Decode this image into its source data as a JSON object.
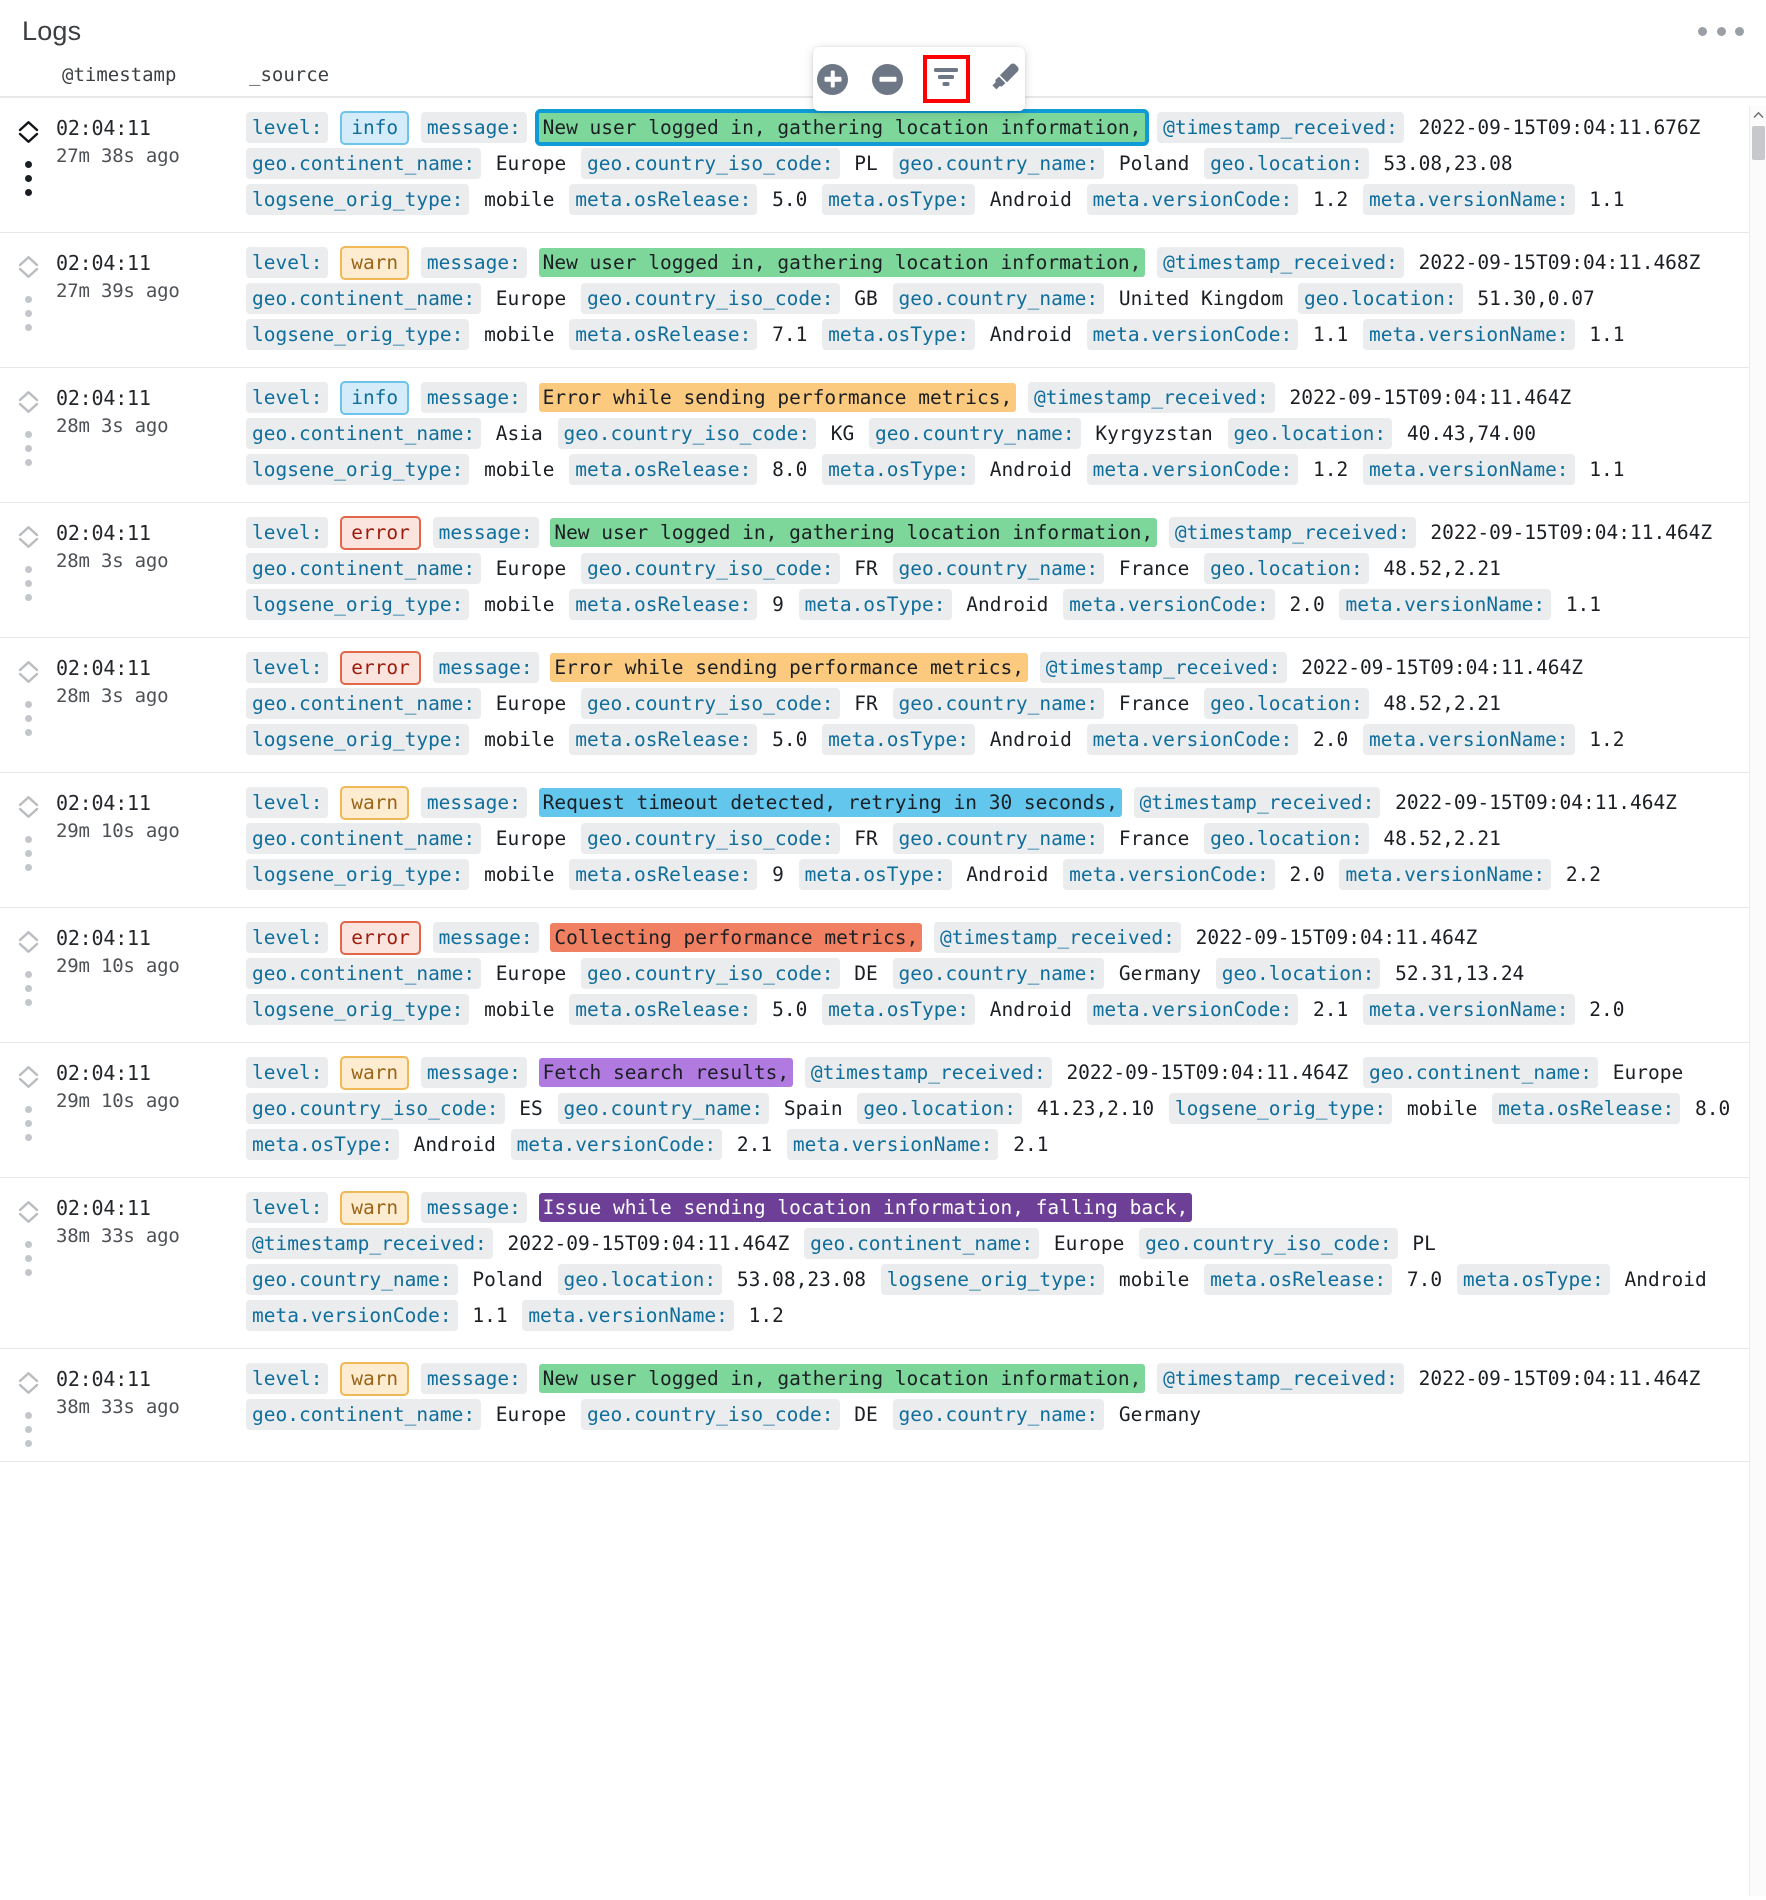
{
  "panel": {
    "title": "Logs",
    "menu_icon": "kebab-menu-icon"
  },
  "toolbar": {
    "buttons": [
      {
        "name": "zoom-in-button",
        "icon": "plus-circle-icon",
        "selected": false
      },
      {
        "name": "zoom-out-button",
        "icon": "minus-circle-icon",
        "selected": false
      },
      {
        "name": "filter-button",
        "icon": "funnel-icon",
        "selected": true
      },
      {
        "name": "highlight-button",
        "icon": "marker-pen-icon",
        "selected": false
      }
    ],
    "selection_color": "#ff0000"
  },
  "columns": {
    "timestamp": "@timestamp",
    "source": "_source"
  },
  "colors": {
    "field_label_text": "#0f6e9b",
    "field_label_bg": "#ebecee",
    "info_bg": "#d4ecf9",
    "warn_bg": "#fdecd0",
    "error_bg": "#fbe3de",
    "hl_green": "#7ed79a",
    "hl_orange": "#fcca7f",
    "hl_cyan": "#62c6ed",
    "hl_salmon": "#f08061",
    "hl_purple": "#b07ae0",
    "hl_darkpurple": "#6d3f96",
    "outline_blue": "#109ad6"
  },
  "rows": [
    {
      "time": "02:04:11",
      "ago": "27m 38s ago",
      "active": true,
      "level": "info",
      "message": "New user logged in, gathering location information,",
      "hl_bg": "#7ed79a",
      "hl_fg": "#1b1f24",
      "outlined": true,
      "fields": [
        {
          "label": "@timestamp_received:",
          "value": "2022-09-15T09:04:11.676Z"
        },
        {
          "label": "geo.continent_name:",
          "value": "Europe"
        },
        {
          "label": "geo.country_iso_code:",
          "value": "PL"
        },
        {
          "label": "geo.country_name:",
          "value": "Poland"
        },
        {
          "label": "geo.location:",
          "value": "53.08,23.08"
        },
        {
          "label": "logsene_orig_type:",
          "value": "mobile"
        },
        {
          "label": "meta.osRelease:",
          "value": "5.0"
        },
        {
          "label": "meta.osType:",
          "value": "Android"
        },
        {
          "label": "meta.versionCode:",
          "value": "1.2"
        },
        {
          "label": "meta.versionName:",
          "value": "1.1"
        }
      ]
    },
    {
      "time": "02:04:11",
      "ago": "27m 39s ago",
      "active": false,
      "level": "warn",
      "message": "New user logged in, gathering location information,",
      "hl_bg": "#7ed79a",
      "hl_fg": "#1b1f24",
      "outlined": false,
      "fields": [
        {
          "label": "@timestamp_received:",
          "value": "2022-09-15T09:04:11.468Z"
        },
        {
          "label": "geo.continent_name:",
          "value": "Europe"
        },
        {
          "label": "geo.country_iso_code:",
          "value": "GB"
        },
        {
          "label": "geo.country_name:",
          "value": "United Kingdom"
        },
        {
          "label": "geo.location:",
          "value": "51.30,0.07"
        },
        {
          "label": "logsene_orig_type:",
          "value": "mobile"
        },
        {
          "label": "meta.osRelease:",
          "value": "7.1"
        },
        {
          "label": "meta.osType:",
          "value": "Android"
        },
        {
          "label": "meta.versionCode:",
          "value": "1.1"
        },
        {
          "label": "meta.versionName:",
          "value": "1.1"
        }
      ]
    },
    {
      "time": "02:04:11",
      "ago": "28m 3s ago",
      "active": false,
      "level": "info",
      "message": "Error while sending performance metrics,",
      "hl_bg": "#fcca7f",
      "hl_fg": "#1b1f24",
      "outlined": false,
      "fields": [
        {
          "label": "@timestamp_received:",
          "value": "2022-09-15T09:04:11.464Z"
        },
        {
          "label": "geo.continent_name:",
          "value": "Asia"
        },
        {
          "label": "geo.country_iso_code:",
          "value": "KG"
        },
        {
          "label": "geo.country_name:",
          "value": "Kyrgyzstan"
        },
        {
          "label": "geo.location:",
          "value": "40.43,74.00"
        },
        {
          "label": "logsene_orig_type:",
          "value": "mobile"
        },
        {
          "label": "meta.osRelease:",
          "value": "8.0"
        },
        {
          "label": "meta.osType:",
          "value": "Android"
        },
        {
          "label": "meta.versionCode:",
          "value": "1.2"
        },
        {
          "label": "meta.versionName:",
          "value": "1.1"
        }
      ]
    },
    {
      "time": "02:04:11",
      "ago": "28m 3s ago",
      "active": false,
      "level": "error",
      "message": "New user logged in, gathering location information,",
      "hl_bg": "#7ed79a",
      "hl_fg": "#1b1f24",
      "outlined": false,
      "fields": [
        {
          "label": "@timestamp_received:",
          "value": "2022-09-15T09:04:11.464Z"
        },
        {
          "label": "geo.continent_name:",
          "value": "Europe"
        },
        {
          "label": "geo.country_iso_code:",
          "value": "FR"
        },
        {
          "label": "geo.country_name:",
          "value": "France"
        },
        {
          "label": "geo.location:",
          "value": "48.52,2.21"
        },
        {
          "label": "logsene_orig_type:",
          "value": "mobile"
        },
        {
          "label": "meta.osRelease:",
          "value": "9"
        },
        {
          "label": "meta.osType:",
          "value": "Android"
        },
        {
          "label": "meta.versionCode:",
          "value": "2.0"
        },
        {
          "label": "meta.versionName:",
          "value": "1.1"
        }
      ]
    },
    {
      "time": "02:04:11",
      "ago": "28m 3s ago",
      "active": false,
      "level": "error",
      "message": "Error while sending performance metrics,",
      "hl_bg": "#fcca7f",
      "hl_fg": "#1b1f24",
      "outlined": false,
      "fields": [
        {
          "label": "@timestamp_received:",
          "value": "2022-09-15T09:04:11.464Z"
        },
        {
          "label": "geo.continent_name:",
          "value": "Europe"
        },
        {
          "label": "geo.country_iso_code:",
          "value": "FR"
        },
        {
          "label": "geo.country_name:",
          "value": "France"
        },
        {
          "label": "geo.location:",
          "value": "48.52,2.21"
        },
        {
          "label": "logsene_orig_type:",
          "value": "mobile"
        },
        {
          "label": "meta.osRelease:",
          "value": "5.0"
        },
        {
          "label": "meta.osType:",
          "value": "Android"
        },
        {
          "label": "meta.versionCode:",
          "value": "2.0"
        },
        {
          "label": "meta.versionName:",
          "value": "1.2"
        }
      ]
    },
    {
      "time": "02:04:11",
      "ago": "29m 10s ago",
      "active": false,
      "level": "warn",
      "message": "Request timeout detected, retrying in 30 seconds,",
      "hl_bg": "#62c6ed",
      "hl_fg": "#1b1f24",
      "outlined": false,
      "fields": [
        {
          "label": "@timestamp_received:",
          "value": "2022-09-15T09:04:11.464Z"
        },
        {
          "label": "geo.continent_name:",
          "value": "Europe"
        },
        {
          "label": "geo.country_iso_code:",
          "value": "FR"
        },
        {
          "label": "geo.country_name:",
          "value": "France"
        },
        {
          "label": "geo.location:",
          "value": "48.52,2.21"
        },
        {
          "label": "logsene_orig_type:",
          "value": "mobile"
        },
        {
          "label": "meta.osRelease:",
          "value": "9"
        },
        {
          "label": "meta.osType:",
          "value": "Android"
        },
        {
          "label": "meta.versionCode:",
          "value": "2.0"
        },
        {
          "label": "meta.versionName:",
          "value": "2.2"
        }
      ]
    },
    {
      "time": "02:04:11",
      "ago": "29m 10s ago",
      "active": false,
      "level": "error",
      "message": "Collecting performance metrics,",
      "hl_bg": "#f08061",
      "hl_fg": "#1b1f24",
      "outlined": false,
      "fields": [
        {
          "label": "@timestamp_received:",
          "value": "2022-09-15T09:04:11.464Z"
        },
        {
          "label": "geo.continent_name:",
          "value": "Europe"
        },
        {
          "label": "geo.country_iso_code:",
          "value": "DE"
        },
        {
          "label": "geo.country_name:",
          "value": "Germany"
        },
        {
          "label": "geo.location:",
          "value": "52.31,13.24"
        },
        {
          "label": "logsene_orig_type:",
          "value": "mobile"
        },
        {
          "label": "meta.osRelease:",
          "value": "5.0"
        },
        {
          "label": "meta.osType:",
          "value": "Android"
        },
        {
          "label": "meta.versionCode:",
          "value": "2.1"
        },
        {
          "label": "meta.versionName:",
          "value": "2.0"
        }
      ]
    },
    {
      "time": "02:04:11",
      "ago": "29m 10s ago",
      "active": false,
      "level": "warn",
      "message": "Fetch search results,",
      "hl_bg": "#b07ae0",
      "hl_fg": "#1b1f24",
      "outlined": false,
      "fields": [
        {
          "label": "@timestamp_received:",
          "value": "2022-09-15T09:04:11.464Z"
        },
        {
          "label": "geo.continent_name:",
          "value": "Europe"
        },
        {
          "label": "geo.country_iso_code:",
          "value": "ES"
        },
        {
          "label": "geo.country_name:",
          "value": "Spain"
        },
        {
          "label": "geo.location:",
          "value": "41.23,2.10"
        },
        {
          "label": "logsene_orig_type:",
          "value": "mobile"
        },
        {
          "label": "meta.osRelease:",
          "value": "8.0"
        },
        {
          "label": "meta.osType:",
          "value": "Android"
        },
        {
          "label": "meta.versionCode:",
          "value": "2.1"
        },
        {
          "label": "meta.versionName:",
          "value": "2.1"
        }
      ]
    },
    {
      "time": "02:04:11",
      "ago": "38m 33s ago",
      "active": false,
      "level": "warn",
      "message": "Issue while sending location information, falling back,",
      "hl_bg": "#6d3f96",
      "hl_fg": "#ffffff",
      "outlined": false,
      "fields": [
        {
          "label": "@timestamp_received:",
          "value": "2022-09-15T09:04:11.464Z"
        },
        {
          "label": "geo.continent_name:",
          "value": "Europe"
        },
        {
          "label": "geo.country_iso_code:",
          "value": "PL"
        },
        {
          "label": "geo.country_name:",
          "value": "Poland"
        },
        {
          "label": "geo.location:",
          "value": "53.08,23.08"
        },
        {
          "label": "logsene_orig_type:",
          "value": "mobile"
        },
        {
          "label": "meta.osRelease:",
          "value": "7.0"
        },
        {
          "label": "meta.osType:",
          "value": "Android"
        },
        {
          "label": "meta.versionCode:",
          "value": "1.1"
        },
        {
          "label": "meta.versionName:",
          "value": "1.2"
        }
      ]
    },
    {
      "time": "02:04:11",
      "ago": "38m 33s ago",
      "active": false,
      "level": "warn",
      "message": "New user logged in, gathering location information,",
      "hl_bg": "#7ed79a",
      "hl_fg": "#1b1f24",
      "outlined": false,
      "fields": [
        {
          "label": "@timestamp_received:",
          "value": "2022-09-15T09:04:11.464Z"
        },
        {
          "label": "geo.continent_name:",
          "value": "Europe"
        },
        {
          "label": "geo.country_iso_code:",
          "value": "DE"
        },
        {
          "label": "geo.country_name:",
          "value": "Germany"
        }
      ]
    }
  ],
  "scrollbar": {
    "up_icon": "chevron-up-icon",
    "position_pct": 1
  }
}
